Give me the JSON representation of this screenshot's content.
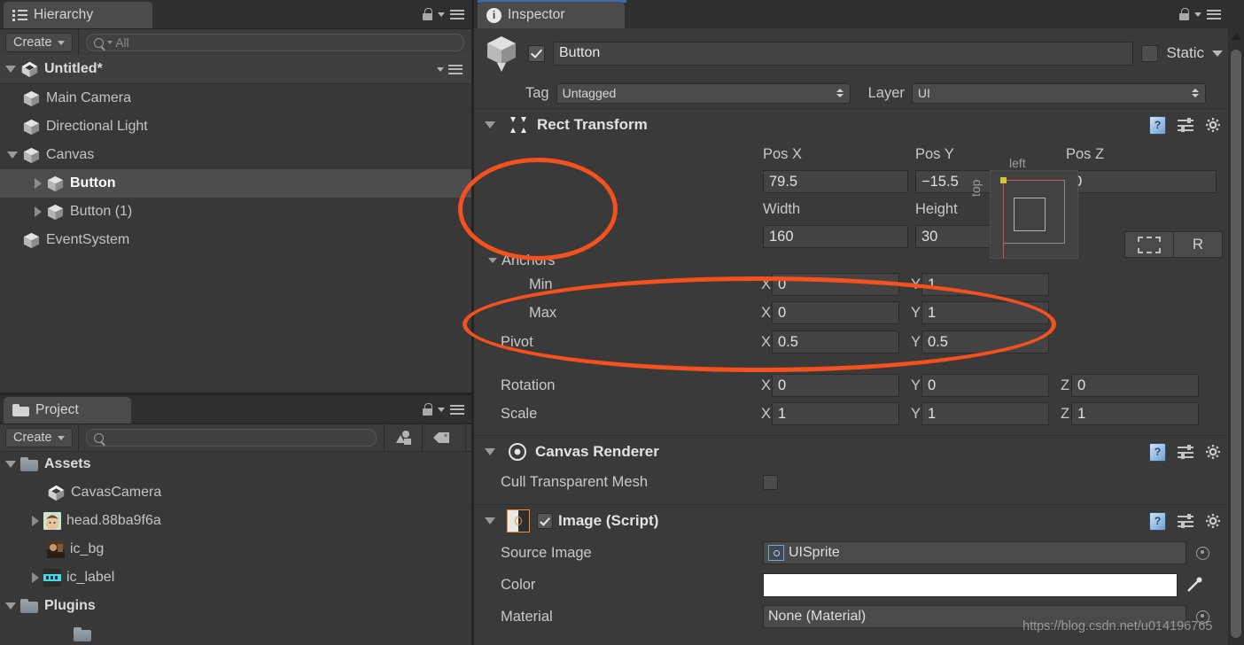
{
  "hierarchy": {
    "tab_label": "Hierarchy",
    "tab_icon": "hierarchy-icon",
    "create_label": "Create",
    "search_placeholder": "All",
    "scene_name": "Untitled*",
    "items": [
      {
        "label": "Main Camera",
        "depth": 1,
        "arrow": "none",
        "icon": "cube-icon",
        "selected": false
      },
      {
        "label": "Directional Light",
        "depth": 1,
        "arrow": "none",
        "icon": "cube-icon",
        "selected": false
      },
      {
        "label": "Canvas",
        "depth": 1,
        "arrow": "down",
        "icon": "cube-icon",
        "selected": false
      },
      {
        "label": "Button",
        "depth": 2,
        "arrow": "right",
        "icon": "cube-icon",
        "selected": true
      },
      {
        "label": "Button (1)",
        "depth": 2,
        "arrow": "right",
        "icon": "cube-icon",
        "selected": false
      },
      {
        "label": "EventSystem",
        "depth": 1,
        "arrow": "none",
        "icon": "cube-icon",
        "selected": false
      }
    ]
  },
  "project": {
    "tab_label": "Project",
    "tab_icon": "folder-icon",
    "create_label": "Create",
    "search_placeholder": "",
    "items": [
      {
        "label": "Assets",
        "depth": 0,
        "arrow": "down",
        "icon": "folder-icon"
      },
      {
        "label": "CavasCamera",
        "depth": 1,
        "arrow": "none",
        "icon": "unity-logo-icon"
      },
      {
        "label": "head.88ba9f6a",
        "depth": 1,
        "arrow": "right",
        "icon": "image-thumb-head"
      },
      {
        "label": "ic_bg",
        "depth": 1,
        "arrow": "none",
        "icon": "image-thumb-bg"
      },
      {
        "label": "ic_label",
        "depth": 1,
        "arrow": "right",
        "icon": "image-thumb-label"
      },
      {
        "label": "Plugins",
        "depth": 0,
        "arrow": "down",
        "icon": "folder-icon"
      }
    ]
  },
  "inspector": {
    "tab_label": "Inspector",
    "tab_icon": "info-icon",
    "object": {
      "enabled": true,
      "name": "Button",
      "static_label": "Static",
      "static_checked": false,
      "tag_label": "Tag",
      "tag_value": "Untagged",
      "layer_label": "Layer",
      "layer_value": "UI"
    },
    "rect_transform": {
      "title": "Rect Transform",
      "anchor_preset_left": "left",
      "anchor_preset_top": "top",
      "headers": {
        "pos_x": "Pos X",
        "pos_y": "Pos Y",
        "pos_z": "Pos Z",
        "width": "Width",
        "height": "Height"
      },
      "pos_x": "79.5",
      "pos_y": "−15.5",
      "pos_z": "0",
      "width": "160",
      "height": "30",
      "blueprint_button": "",
      "raw_button": "R",
      "anchors_label": "Anchors",
      "min_label": "Min",
      "max_label": "Max",
      "pivot_label": "Pivot",
      "rotation_label": "Rotation",
      "scale_label": "Scale",
      "axis_x": "X",
      "axis_y": "Y",
      "axis_z": "Z",
      "anchor_min": {
        "x": "0",
        "y": "1"
      },
      "anchor_max": {
        "x": "0",
        "y": "1"
      },
      "pivot": {
        "x": "0.5",
        "y": "0.5"
      },
      "rotation": {
        "x": "0",
        "y": "0",
        "z": "0"
      },
      "scale": {
        "x": "1",
        "y": "1",
        "z": "1"
      }
    },
    "canvas_renderer": {
      "title": "Canvas Renderer",
      "cull_label": "Cull Transparent Mesh",
      "cull_checked": false
    },
    "image_script": {
      "title": "Image (Script)",
      "enabled": true,
      "source_image_label": "Source Image",
      "source_image_value": "UISprite",
      "color_label": "Color",
      "color_value": "#FFFFFF",
      "material_label": "Material",
      "material_value": "None (Material)"
    }
  },
  "annotations": {
    "accent_color": "#F4511E",
    "ellipse_anchor_preview": "highlights the anchor preset preview widget",
    "ellipse_anchors": "highlights the Anchors Min/Max rows"
  },
  "watermark": "https://blog.csdn.net/u014196765"
}
